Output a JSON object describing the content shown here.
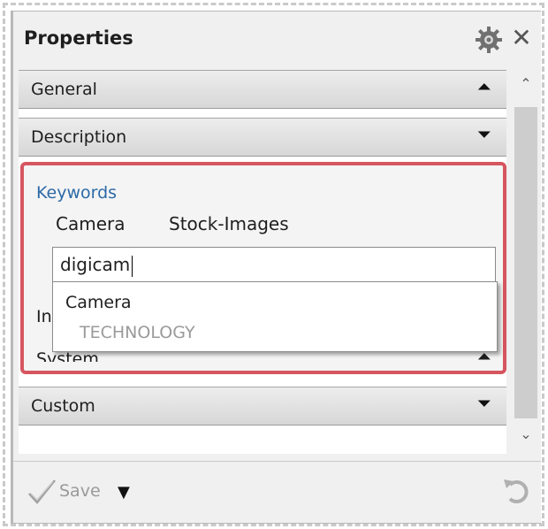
{
  "panel": {
    "title": "Properties"
  },
  "sections": {
    "general": "General",
    "description": "Description",
    "system": "System",
    "custom": "Custom"
  },
  "keywords": {
    "label": "Keywords",
    "tags": [
      "Camera",
      "Stock-Images"
    ],
    "input_value": "digicam"
  },
  "autocomplete": {
    "title": "Camera",
    "subtitle": "TECHNOLOGY"
  },
  "hidden_section_prefix": "In",
  "footer": {
    "save_label": "Save"
  },
  "colors": {
    "highlight_border": "#d6565f",
    "keywords_label": "#2c6aa6"
  },
  "icons": [
    "gear-icon",
    "close-icon",
    "chevron-up-icon",
    "chevron-down-icon",
    "checkmark-icon",
    "undo-icon"
  ]
}
